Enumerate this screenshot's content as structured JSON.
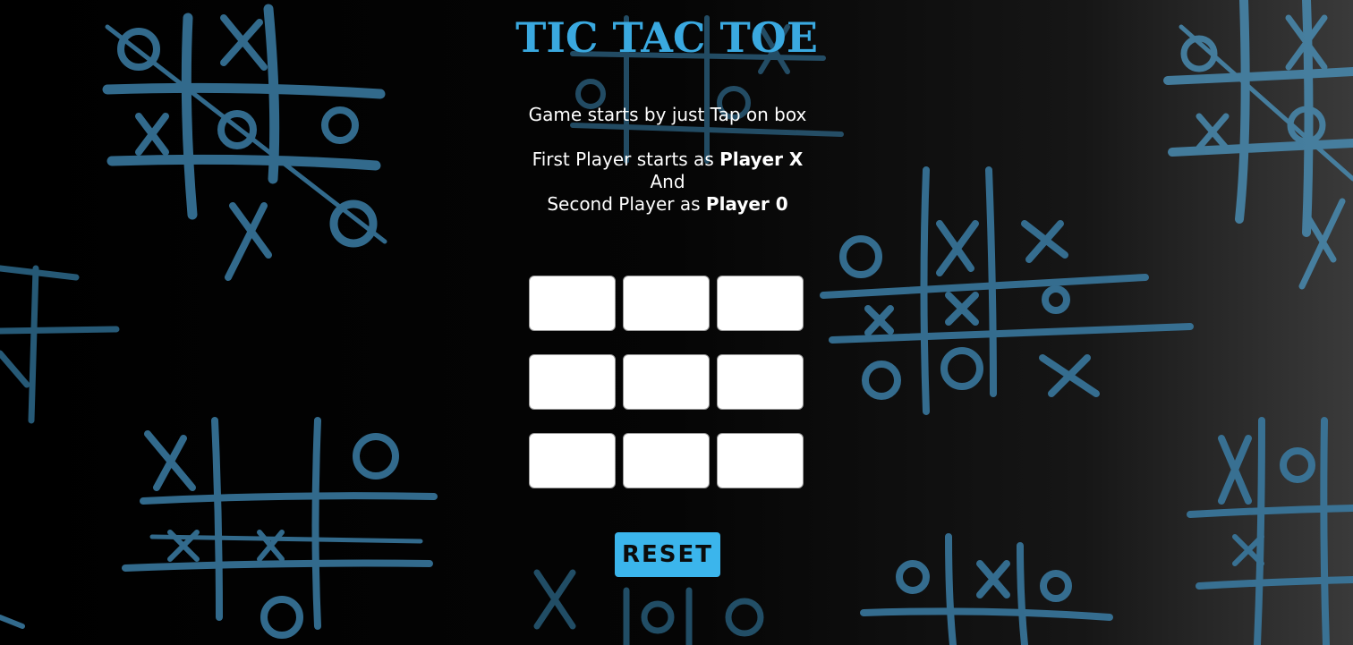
{
  "title": "TIC TAC TOE",
  "instructions": {
    "line1": "Game starts by just Tap on box",
    "line2_prefix": "First Player starts as ",
    "line2_bold": "Player X",
    "line3": "And",
    "line4_prefix": "Second Player as ",
    "line4_bold": "Player 0"
  },
  "board": {
    "cells": [
      "",
      "",
      "",
      "",
      "",
      "",
      "",
      "",
      ""
    ]
  },
  "reset_label": "RESET",
  "colors": {
    "accent": "#3aa9e0",
    "button": "#3bb5ec",
    "background": "#000000",
    "doodle": "#2e6f94"
  }
}
